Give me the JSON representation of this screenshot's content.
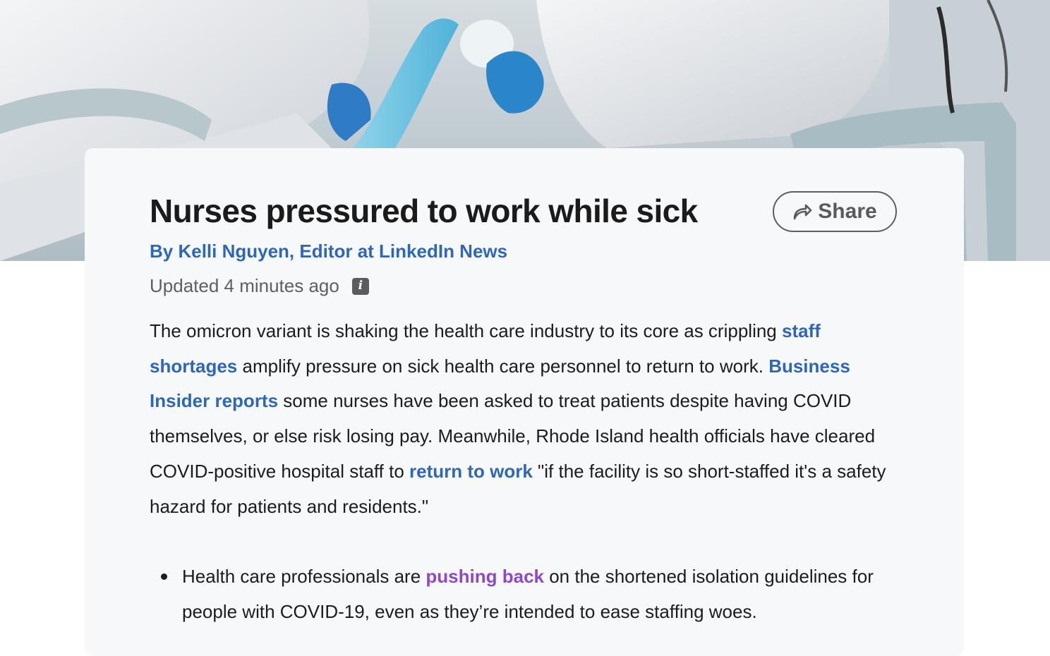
{
  "article": {
    "hero_image": "nurses-in-protective-gear-photo",
    "title": "Nurses pressured to work while sick",
    "share_icon": "share-arrow-icon",
    "share_label": "Share",
    "byline": "By Kelli Nguyen, Editor at LinkedIn News",
    "updated": "Updated 4 minutes ago",
    "info_icon": "info-icon",
    "paragraph": {
      "t1": "The omicron variant is shaking the health care industry to its core as crippling ",
      "link1": "staff shortages",
      "t2": " amplify pressure on sick health care personnel to return to work. ",
      "link2": "Business Insider reports",
      "t3": " some nurses have been asked to treat patients despite having COVID themselves, or else risk losing pay. Meanwhile, Rhode Island health officials have cleared COVID-positive hospital staff to ",
      "link3": "return to work",
      "t4": " \"if the facility is so short-staffed it's a safety hazard for patients and residents.\""
    },
    "bullets": [
      {
        "t1": "Health care professionals are ",
        "link": "pushing back",
        "t2": " on the shortened isolation guidelines for people with COVID-19, even as they’re intended to ease staffing woes."
      }
    ]
  },
  "colors": {
    "link": "#2f67b6",
    "visited_link": "#8e48c9",
    "card_background": "#f7f8fa",
    "text": "#1c1c1c"
  }
}
